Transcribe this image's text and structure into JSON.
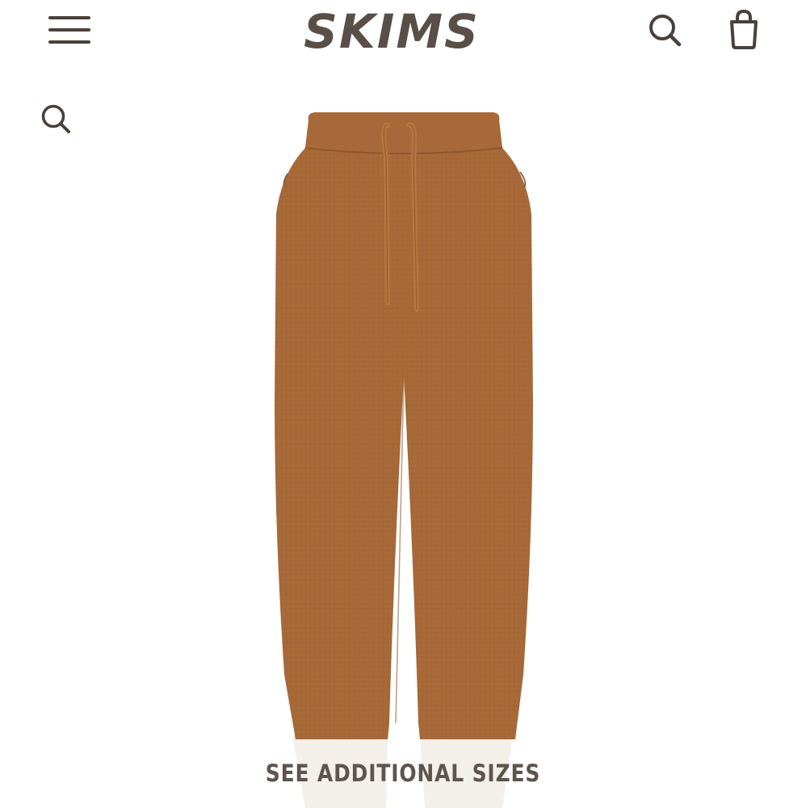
{
  "header": {
    "brand": "SKIMS",
    "menu_icon": "hamburger-menu-icon",
    "search_icon": "search-icon",
    "bag_icon": "shopping-bag-icon",
    "icon_color": "#4a403a"
  },
  "page_search": {
    "icon": "search-icon"
  },
  "product": {
    "image_subject": "waffle knit jogger pants",
    "color": "#a86a38",
    "cuff_color": "#f3efe9"
  },
  "actions": {
    "see_sizes_label": "SEE ADDITIONAL SIZES"
  }
}
